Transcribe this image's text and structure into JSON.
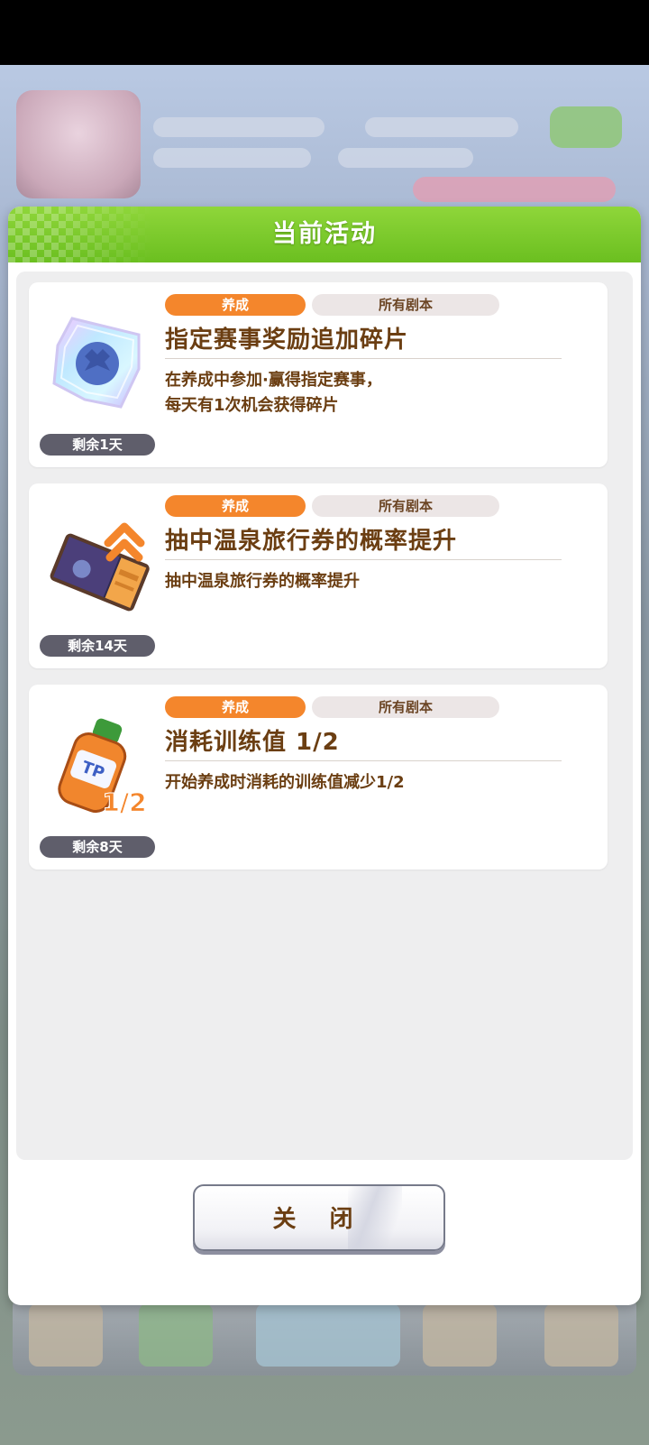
{
  "modal": {
    "title": "当前活动",
    "close_label": "关 闭"
  },
  "events": [
    {
      "icon": "star-shard-icon",
      "tag_primary": "养成",
      "tag_secondary": "所有剧本",
      "title": "指定赛事奖励追加碎片",
      "desc_line1": "在养成中参加·赢得指定赛事，",
      "desc_line2": "每天有1次机会获得碎片",
      "remaining": "剩余1天"
    },
    {
      "icon": "hot-spring-ticket-icon",
      "tag_primary": "养成",
      "tag_secondary": "所有剧本",
      "title": "抽中温泉旅行券的概率提升",
      "desc_line1": "抽中温泉旅行券的概率提升",
      "desc_line2": "",
      "remaining": "剩余14天"
    },
    {
      "icon": "tp-bottle-icon",
      "icon_badge": "1/2",
      "tag_primary": "养成",
      "tag_secondary": "所有剧本",
      "title": "消耗训练值 1/2",
      "desc_line1": "开始养成时消耗的训练值减少1/2",
      "desc_line2": "",
      "remaining": "剩余8天"
    }
  ],
  "colors": {
    "header_green": "#6bbf20",
    "tag_orange": "#f4862c",
    "text_brown": "#6b3e12",
    "remaining_gray": "#5f5e6b"
  }
}
